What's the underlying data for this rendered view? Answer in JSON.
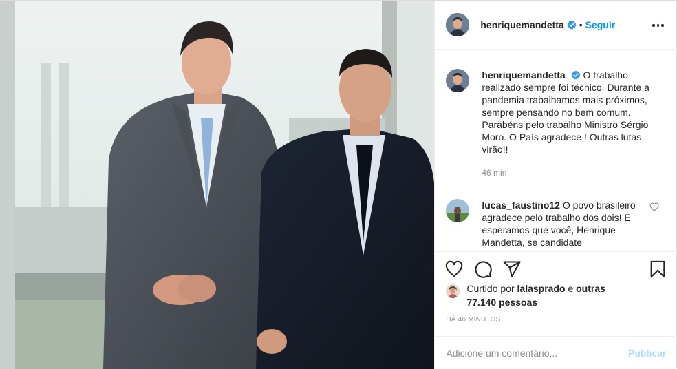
{
  "post": {
    "author": "henriquemandetta",
    "follow_label": "Seguir",
    "separator": "•",
    "photo_alt": "Foto de dois homens de terno em frente a uma janela"
  },
  "caption": {
    "username": "henriquemandetta",
    "text": "O trabalho realizado sempre foi técnico. Durante a pandemia trabalhamos mais próximos, sempre pensando no bem comum. Parabéns pelo trabalho Ministro Sérgio Moro. O País agradece ! Outras lutas virão!!",
    "time": "46 min"
  },
  "reply": {
    "username": "lucas_faustino12",
    "text": "O povo brasileiro agradece pelo trabalho dos dois! E esperamos que você, Henrique Mandetta, se candidate"
  },
  "likes": {
    "prefix": "Curtido por",
    "user": "lalasprado",
    "joiner": "e",
    "others": "outras 77.140 pessoas"
  },
  "timestamp": "HÁ 46 MINUTOS",
  "comment_box": {
    "placeholder": "Adicione um comentário...",
    "publish_label": "Publicar"
  },
  "icons": {
    "verified": "verified-badge-icon",
    "more": "more-options-icon",
    "like": "heart-icon",
    "comment": "comment-icon",
    "share": "share-icon",
    "save": "bookmark-icon"
  },
  "colors": {
    "accent": "#0095f6",
    "verified": "#3897f0",
    "publish_disabled": "#b2dffc",
    "muted": "#8e8e8e"
  }
}
